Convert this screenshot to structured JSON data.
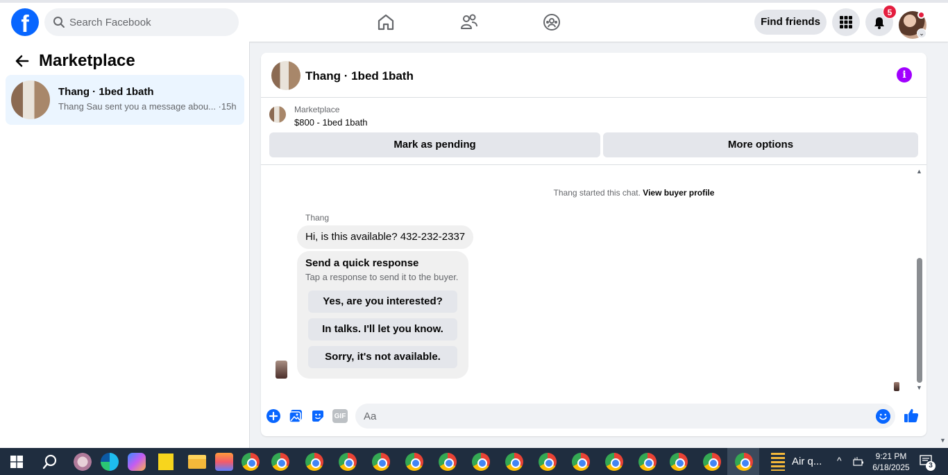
{
  "topbar": {
    "search_placeholder": "Search Facebook",
    "find_friends_label": "Find friends",
    "notification_count": "5",
    "icons": [
      "facebook-logo",
      "search-icon",
      "home-icon",
      "friends-icon",
      "groups-icon",
      "menu-grid-icon",
      "bell-icon",
      "avatar"
    ]
  },
  "sidebar": {
    "title": "Marketplace",
    "conversations": [
      {
        "title": "Thang · 1bed 1bath",
        "preview": "Thang Sau sent you a message abou... ·15h"
      }
    ]
  },
  "chat": {
    "header_title": "Thang · 1bed 1bath",
    "marketplace_label": "Marketplace",
    "listing_price_title": "$800 - 1bed 1bath",
    "mark_pending_label": "Mark as pending",
    "more_options_label": "More options",
    "started_text": "Thang started this chat.",
    "view_profile_label": "View buyer profile",
    "sender_name": "Thang",
    "message": "Hi, is this available? 432-232-2337",
    "quick_title": "Send a quick response",
    "quick_subtitle": "Tap a response to send it to the buyer.",
    "quick_responses": [
      "Yes, are you interested?",
      "In talks. I'll let you know.",
      "Sorry, it's not available."
    ],
    "composer_placeholder": "Aa",
    "gif_label": "GIF"
  },
  "taskbar": {
    "weather_text": "Air q...",
    "time": "9:21 PM",
    "date": "6/18/2025",
    "notification_count": "3"
  },
  "colors": {
    "brand_blue": "#0866ff",
    "badge_red": "#e41e3f",
    "info_purple": "#a100ff",
    "selected_bg": "#ebf5ff",
    "taskbar_bg": "#1f2d3f"
  }
}
